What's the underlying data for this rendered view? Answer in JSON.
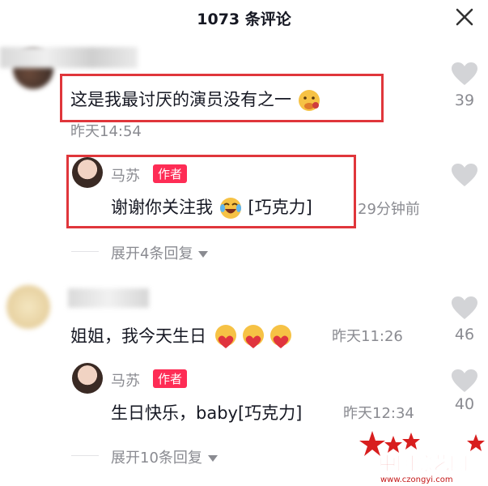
{
  "header": {
    "title": "1073 条评论"
  },
  "icons": {
    "close": "close-icon",
    "like": "heart-icon",
    "expand": "caret-down-icon"
  },
  "colors": {
    "accent": "#fe2c55",
    "highlight_box": "#e0363b",
    "muted": "#8a8b91"
  },
  "comments": [
    {
      "text": "这是我最讨厌的演员没有之一",
      "emoji": "sick-face-emoji",
      "time": "昨天14:54",
      "likes": "39",
      "reply": {
        "username": "马苏",
        "badge": "作者",
        "text": "谢谢你关注我",
        "emoji": "laughing-tears-emoji",
        "tag": "[巧克力]",
        "time": "29分钟前"
      },
      "expand": "展开4条回复"
    },
    {
      "text": "姐姐，我今天生日",
      "emojis": [
        "heart-emoji",
        "heart-emoji",
        "heart-emoji"
      ],
      "time": "昨天11:26",
      "likes": "46",
      "reply": {
        "username": "马苏",
        "badge": "作者",
        "text": "生日快乐，baby[巧克力]",
        "time": "昨天12:34",
        "likes": "40"
      },
      "expand": "展开10条回复"
    }
  ],
  "watermark": {
    "logo": "中国综艺网",
    "url": "www.czongyi.com"
  }
}
